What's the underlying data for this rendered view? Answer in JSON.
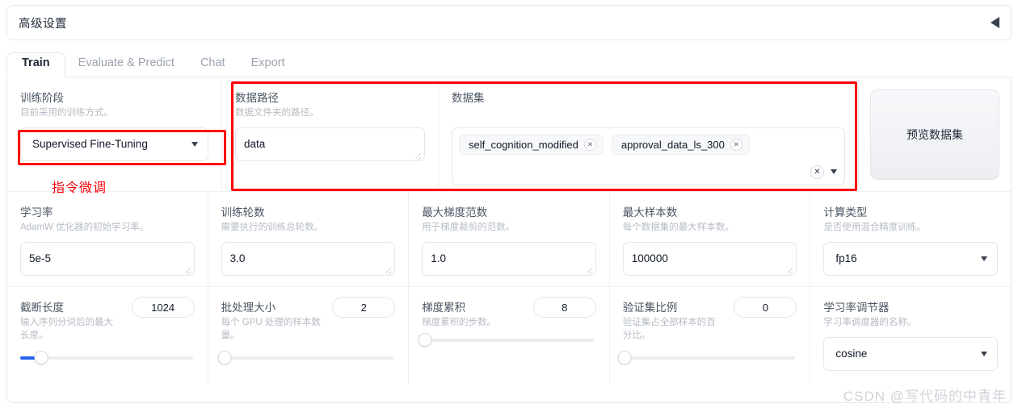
{
  "accordion": {
    "title": "高级设置",
    "arrow_icon": "caret-left-icon"
  },
  "tabs": [
    {
      "label": "Train",
      "active": true
    },
    {
      "label": "Evaluate & Predict",
      "active": false
    },
    {
      "label": "Chat",
      "active": false
    },
    {
      "label": "Export",
      "active": false
    }
  ],
  "row1": {
    "stage": {
      "label": "训练阶段",
      "hint": "目前采用的训练方式。",
      "value": "Supervised Fine-Tuning",
      "caret_icon": "chevron-down-icon"
    },
    "data_dir": {
      "label": "数据路径",
      "hint": "数据文件夹的路径。",
      "value": "data"
    },
    "dataset": {
      "label": "数据集",
      "tags": [
        {
          "name": "self_cognition_modified",
          "remove_icon": "close-icon"
        },
        {
          "name": "approval_data_ls_300",
          "remove_icon": "close-icon"
        }
      ],
      "clear_icon": "clear-all-icon",
      "caret_icon": "chevron-down-icon"
    },
    "preview_button": {
      "label": "预览数据集"
    }
  },
  "row2": [
    {
      "label": "学习率",
      "hint": "AdamW 优化器的初始学习率。",
      "value": "5e-5",
      "type": "textarea"
    },
    {
      "label": "训练轮数",
      "hint": "需要执行的训练总轮数。",
      "value": "3.0",
      "type": "textarea"
    },
    {
      "label": "最大梯度范数",
      "hint": "用于梯度裁剪的范数。",
      "value": "1.0",
      "type": "textarea"
    },
    {
      "label": "最大样本数",
      "hint": "每个数据集的最大样本数。",
      "value": "100000",
      "type": "textarea"
    },
    {
      "label": "计算类型",
      "hint": "是否使用混合精度训练。",
      "value": "fp16",
      "type": "dropdown",
      "caret_icon": "chevron-down-icon"
    }
  ],
  "row3": [
    {
      "label": "截断长度",
      "hint": "输入序列分词后的最大长度。",
      "value": "1024",
      "type": "slider",
      "fill_pct": 12
    },
    {
      "label": "批处理大小",
      "hint": "每个 GPU 处理的样本数量。",
      "value": "2",
      "type": "slider",
      "fill_pct": 2
    },
    {
      "label": "梯度累积",
      "hint": "梯度累积的步数。",
      "value": "8",
      "type": "slider",
      "fill_pct": 2
    },
    {
      "label": "验证集比例",
      "hint": "验证集占全部样本的百分比。",
      "value": "0",
      "type": "slider",
      "fill_pct": 0
    },
    {
      "label": "学习率调节器",
      "hint": "学习率调度器的名称。",
      "value": "cosine",
      "type": "dropdown",
      "caret_icon": "chevron-down-icon"
    }
  ],
  "annotations": {
    "stage_note": "指令微调",
    "accent_red": "#fb0007"
  },
  "watermark": {
    "text": "CSDN @写代码的中青年"
  }
}
